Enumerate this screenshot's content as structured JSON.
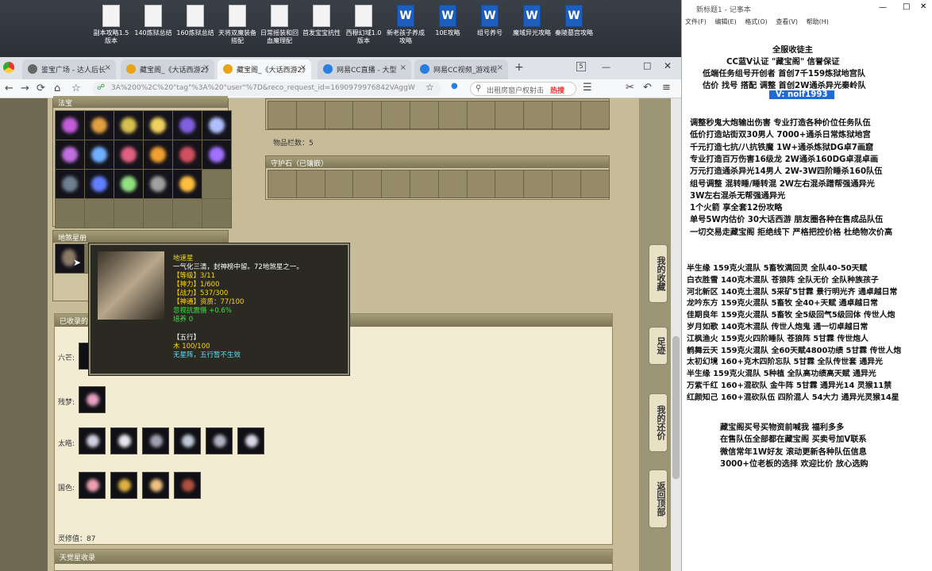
{
  "desktop_icons": [
    {
      "label": "副本攻略1.5版本",
      "type": "doc"
    },
    {
      "label": "140炼狱总结",
      "type": "doc"
    },
    {
      "label": "160炼狱总结",
      "type": "doc"
    },
    {
      "label": "天将双魔装备搭配",
      "type": "doc"
    },
    {
      "label": "日常摇装和回血魔理配",
      "type": "doc"
    },
    {
      "label": "首发宝宝抗性",
      "type": "doc"
    },
    {
      "label": "西穆幻域1.0版本",
      "type": "doc"
    },
    {
      "label": "新老孩子养成攻略",
      "type": "word"
    },
    {
      "label": "10E攻略",
      "type": "word"
    },
    {
      "label": "组号养号",
      "type": "word"
    },
    {
      "label": "魔域异光攻略",
      "type": "word"
    },
    {
      "label": "秦陵墓宫攻略",
      "type": "word"
    }
  ],
  "browser": {
    "tabs": [
      {
        "label": "鉴宝广场 - 达人后长",
        "color": "#666"
      },
      {
        "label": "藏宝阁_《大话西游2》",
        "color": "#e8a317"
      },
      {
        "label": "藏宝阁_《大话西游2》",
        "color": "#e8a317"
      },
      {
        "label": "网易CC直播 - 大型",
        "color": "#2a7de1"
      },
      {
        "label": "网易CC视频_游戏视",
        "color": "#2a7de1"
      }
    ],
    "tab_count": "5",
    "url": "3A%200%2C%20\"tag\"%3A%20\"user\"%7D&reco_request_id=1690979976842VAggW",
    "search_placeholder": "出租房窗户权射击",
    "hot_label": "热搜"
  },
  "game": {
    "fabao_title": "法宝",
    "dishaxing_title": "地煞星册",
    "item_count": "物品栏数：5",
    "guardian_title": "守护石（已镶嵌）",
    "collected_title": "已收录的",
    "rows": [
      {
        "label": "六芒:",
        "count": 1
      },
      {
        "label": "残梦:",
        "count": 1
      },
      {
        "label": "太皓:",
        "count": 6
      },
      {
        "label": "国色:",
        "count": 4
      }
    ],
    "lingxiu": "灵修值：87",
    "tianjue_title": "天觉星收录",
    "side_buttons": [
      "我的收藏",
      "足迹",
      "我的还价",
      "返回顶部"
    ]
  },
  "tooltip": {
    "name": "地速星",
    "desc": "一气化三清，封神榜中留。72地煞星之一。",
    "level": "【等级】3/11",
    "power": "【神力】1/600",
    "combat": "【战力】537/300",
    "shentong": "【神通】资质：77/100",
    "effect": "忽视抗震慑 +0.6%",
    "peiyang": "培养 0",
    "wuxing_title": "【五行】",
    "wuxing_val": "木 100/100",
    "wuxing_note": "无星阵，五行暂不生效"
  },
  "notepad": {
    "title": "新标题1 - 记事本",
    "menu": [
      "文件(F)",
      "编辑(E)",
      "格式(O)",
      "查看(V)",
      "帮助(H)"
    ],
    "header_lines": [
      "全服收徒主",
      "CC蓝V认证  \"藏宝阁\"  信誉保证",
      "低端任务组号开创者          首创7千159炼狱地宫队",
      "估价  找号  搭配  调整         首创2W通杀异光秦岭队"
    ],
    "vx": "V: noif1993",
    "blocks1": [
      "调整秒鬼大炮输出伤害          专业打造各种价位任务队伍",
      "低价打造站街双30男人            7000+通杀日常炼狱地宫",
      "千元打造七抗/八抗铁魔           1W+通杀炼狱DG卓7画窟",
      "专业打造百万伤害16级龙           2W通杀160DG卓混卓画",
      "万元打造通杀异光14男人        2W-3W四阶睡杀160队伍",
      "组号调整  混转睡/睡转混           2W左右混杀蹭帮强通异光",
      "                                       3W左右混杀无帮强通异光"
    ],
    "blocks2": [
      "1个火箭  享全套12份攻略",
      "单号5W内估价  30大话西游          朋友圈各种在售成品队伍",
      "一切交易走藏宝阁  拒绝线下     严格把控价格  杜绝物次价高"
    ],
    "listing": [
      "半生缘    159克火混队  5畜牧满回灵  全队40-50天赋",
      "白衣胜雪  140克木混队  苍狼阵  全队无价  全队种族孩子",
      "河北新区  140克土混队  5采矿5甘霖  景行明光齐  通卓越日常",
      "龙吟东方  159克火混队  5畜牧  全40+天赋  通卓越日常",
      "佳期良年  159克火混队  5畜牧  全5级回气5级回体  传世人炮",
      "岁月如歌  140克木混队  传世人炮鬼  通一切卓越日常",
      "江枫渔火  159克火四阶睡队  苍狼阵  5甘霖  传世炮人",
      "鹤舞云天  159克火混队  全60天赋4800功绩  5甘霖  传世人炮",
      "太初幻境  160+克木四阶忘队  5甘霖  全队传世套  通异光",
      "半生缘    159克火混队  5种植  全队高功绩高天赋  通异光",
      "万紫千红  160+混砍队  金牛阵  5甘霖  通异光14  灵猴11禁",
      "红颜知己  160+混砍队伍  四阶混人  54大力  通异光灵猴14星"
    ],
    "footer": [
      "藏宝阁买号买物资前喊我  福利多多",
      "在售队伍全部都在藏宝阁  买卖号加V联系",
      "微信常年1W好友  滚动更新各种队伍信息",
      "3000+位老板的选择  欢迎比价  放心选购"
    ]
  }
}
